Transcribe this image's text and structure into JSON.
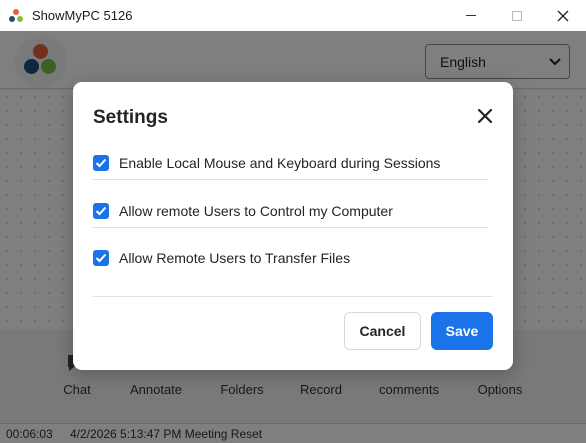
{
  "window": {
    "title": "ShowMyPC 5126",
    "minimize_icon": "minimize-icon",
    "maximize_icon": "maximize-icon",
    "close_icon": "close-icon"
  },
  "header": {
    "language_selected": "English",
    "logo_colors": [
      "#e8603c",
      "#1d4e7a",
      "#7cc242"
    ]
  },
  "toolbar": {
    "items": [
      {
        "label": "Chat",
        "icon": "chat-icon"
      },
      {
        "label": "Annotate",
        "icon": "annotate-icon"
      },
      {
        "label": "Folders",
        "icon": "folder-icon"
      },
      {
        "label": "Record",
        "icon": "record-icon"
      },
      {
        "label": "comments",
        "icon": "comments-icon"
      },
      {
        "label": "Options",
        "icon": "options-icon"
      }
    ]
  },
  "statusbar": {
    "elapsed": "00:06:03",
    "message": "4/2/2026 5:13:47 PM Meeting Reset"
  },
  "settings_modal": {
    "title": "Settings",
    "close_icon": "close-icon",
    "options": [
      {
        "label": "Enable Local Mouse and Keyboard during Sessions",
        "checked": true
      },
      {
        "label": "Allow remote Users to Control my Computer",
        "checked": true
      },
      {
        "label": "Allow Remote Users to Transfer Files",
        "checked": true
      }
    ],
    "cancel_label": "Cancel",
    "save_label": "Save",
    "accent_color": "#1a73e8"
  }
}
